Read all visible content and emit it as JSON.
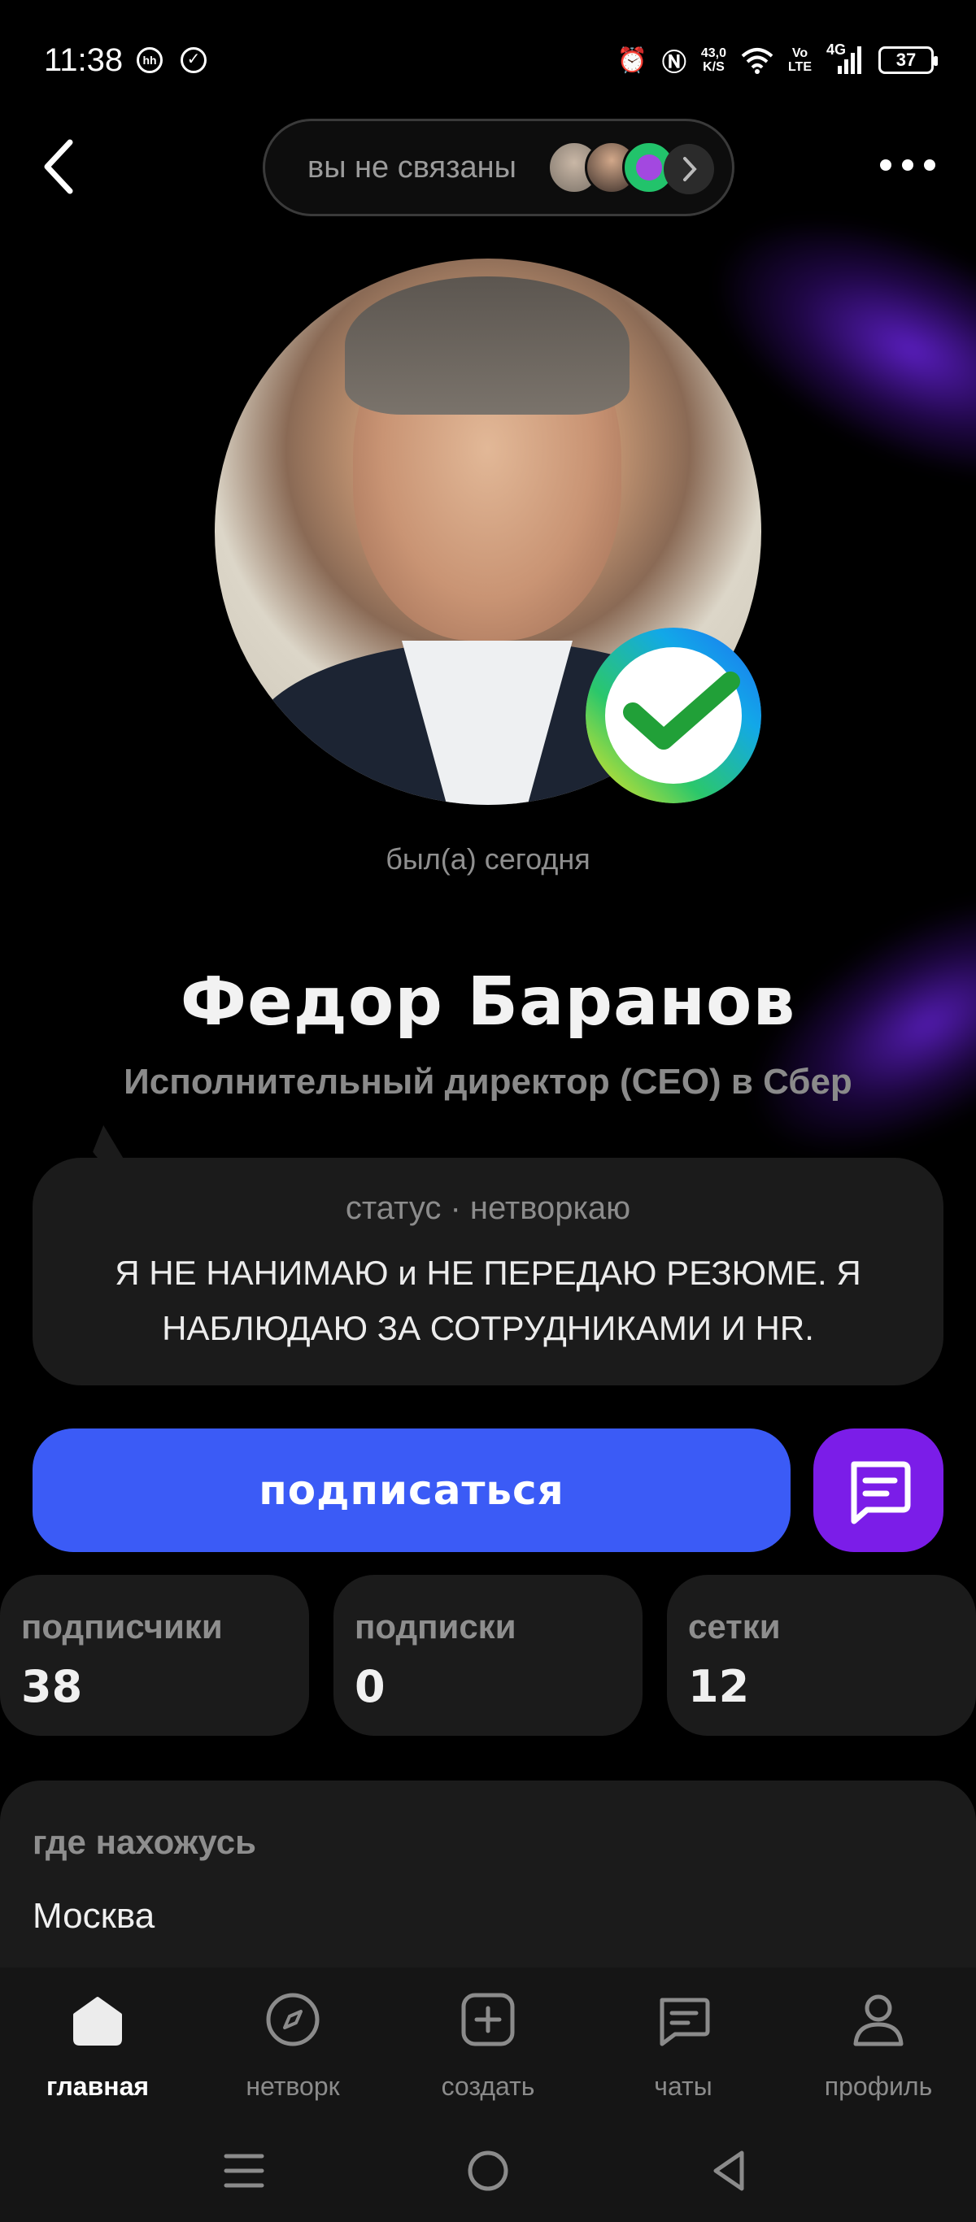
{
  "status_bar": {
    "time": "11:38",
    "net_speed_value": "43,0",
    "net_speed_unit": "K/S",
    "volte_line1": "Vo",
    "volte_line2": "LTE",
    "network": "4G",
    "battery": "37"
  },
  "header": {
    "connection_text": "вы не связаны"
  },
  "profile": {
    "last_seen": "был(а) сегодня",
    "name": "Федор Баранов",
    "position": "Исполнительный директор (CEO) в Сбер"
  },
  "status": {
    "label": "статус · нетворкаю",
    "text": "Я НЕ НАНИМАЮ и НЕ ПЕРЕДАЮ РЕЗЮМЕ. Я НАБЛЮДАЮ ЗА СОТРУДНИКАМИ И HR."
  },
  "actions": {
    "subscribe_label": "подписаться"
  },
  "stats": [
    {
      "label": "подписчики",
      "value": "38"
    },
    {
      "label": "подписки",
      "value": "0"
    },
    {
      "label": "сетки",
      "value": "12"
    }
  ],
  "location": {
    "label": "где нахожусь",
    "value": "Москва"
  },
  "bottom_nav": [
    {
      "label": "главная",
      "icon": "home-icon",
      "active": true
    },
    {
      "label": "нетворк",
      "icon": "compass-icon",
      "active": false
    },
    {
      "label": "создать",
      "icon": "plus-square-icon",
      "active": false
    },
    {
      "label": "чаты",
      "icon": "chat-icon",
      "active": false
    },
    {
      "label": "профиль",
      "icon": "person-icon",
      "active": false
    }
  ],
  "colors": {
    "background": "#000000",
    "card": "#1b1b1b",
    "subscribe_button": "#3b5bf6",
    "chat_button": "#7b1de8",
    "glow": "#7828ff"
  }
}
